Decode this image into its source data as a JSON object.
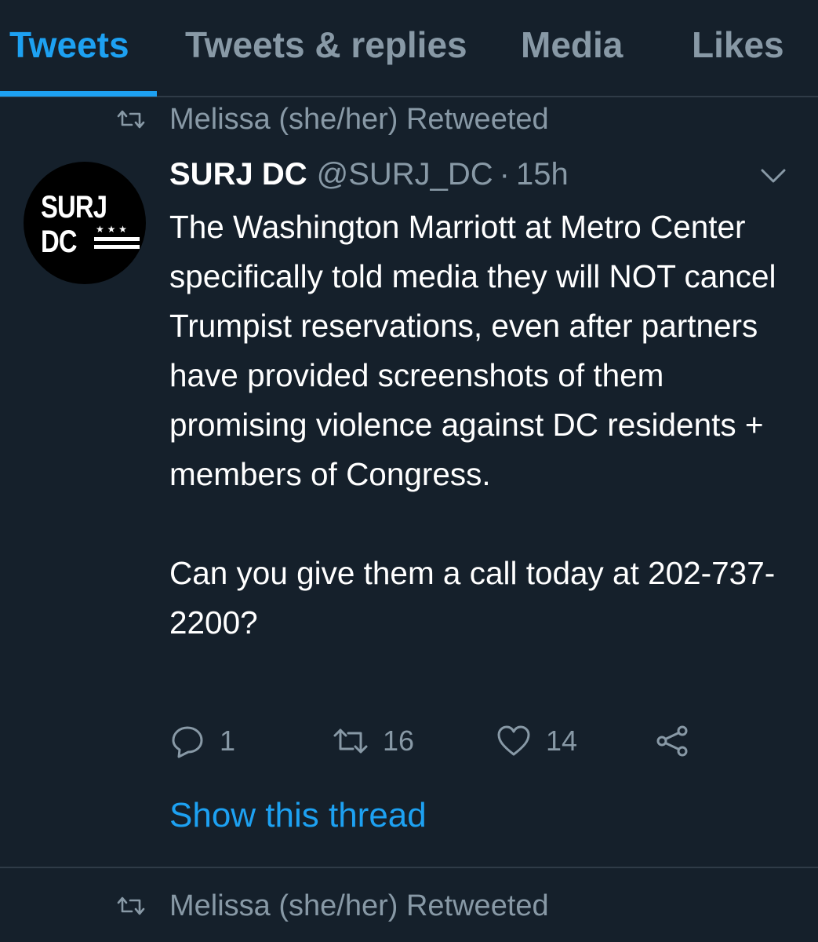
{
  "tabs": [
    {
      "label": "Tweets",
      "active": true
    },
    {
      "label": "Tweets & replies",
      "active": false
    },
    {
      "label": "Media",
      "active": false
    },
    {
      "label": "Likes",
      "active": false
    }
  ],
  "colors": {
    "background": "#15202b",
    "accent": "#1da1f2",
    "muted": "#8899a6",
    "divider": "#2f3b47"
  },
  "tweets": [
    {
      "retweeted_by": "Melissa (she/her) Retweeted",
      "avatar": {
        "line1": "SURJ",
        "line2": "DC"
      },
      "author_name": "SURJ DC",
      "handle": "@SURJ_DC",
      "separator": "·",
      "time": "15h",
      "text_paragraphs": [
        "The Washington Marriott at Metro Center specifically told media they will NOT cancel Trumpist reservations, even after partners have provided screenshots of them promising violence against DC residents + members of Congress.",
        "Can you give them a call today at 202-737-2200?"
      ],
      "reply_count": "1",
      "retweet_count": "16",
      "like_count": "14",
      "show_thread_label": "Show this thread"
    },
    {
      "retweeted_by": "Melissa (she/her) Retweeted"
    }
  ],
  "icons": [
    "retweet-icon",
    "chevron-down-icon",
    "reply-icon",
    "like-icon",
    "share-icon"
  ]
}
